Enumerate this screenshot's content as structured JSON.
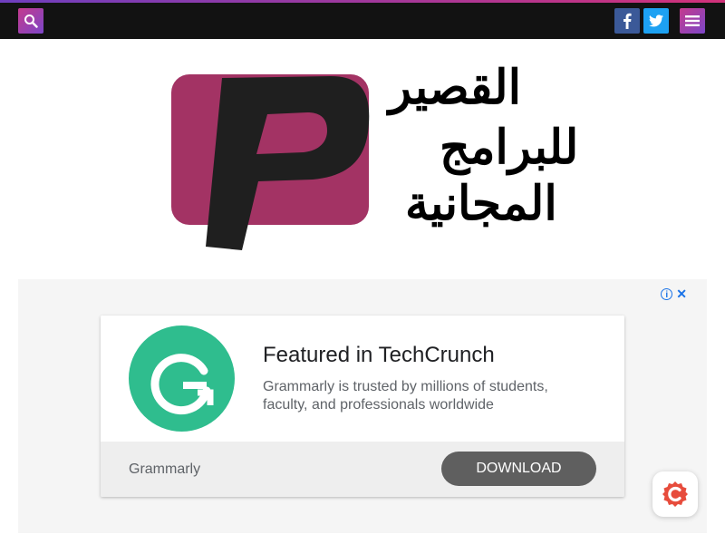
{
  "header": {
    "search_icon": "search-icon",
    "facebook_icon": "facebook-icon",
    "twitter_icon": "twitter-icon",
    "menu_icon": "hamburger-menu-icon",
    "colors": {
      "bar": "#121212",
      "accent_start": "#c43a8d",
      "accent_end": "#7c46c8",
      "facebook": "#3b5998",
      "twitter": "#1da1f2"
    }
  },
  "logo": {
    "line1": "القصير",
    "line2": "للبرامج",
    "line3": "المجانية",
    "mark_color": "#a33364"
  },
  "ad": {
    "title": "Featured in TechCrunch",
    "description": "Grammarly is trusted by millions of students, faculty, and professionals worldwide",
    "brand": "Grammarly",
    "cta": "DOWNLOAD",
    "info_icon": "info-icon",
    "close_icon": "close-icon",
    "logo_icon": "grammarly-logo-icon",
    "logo_color": "#2fbd8e"
  },
  "floating": {
    "icon": "badge-icon",
    "color": "#e74c3c"
  }
}
